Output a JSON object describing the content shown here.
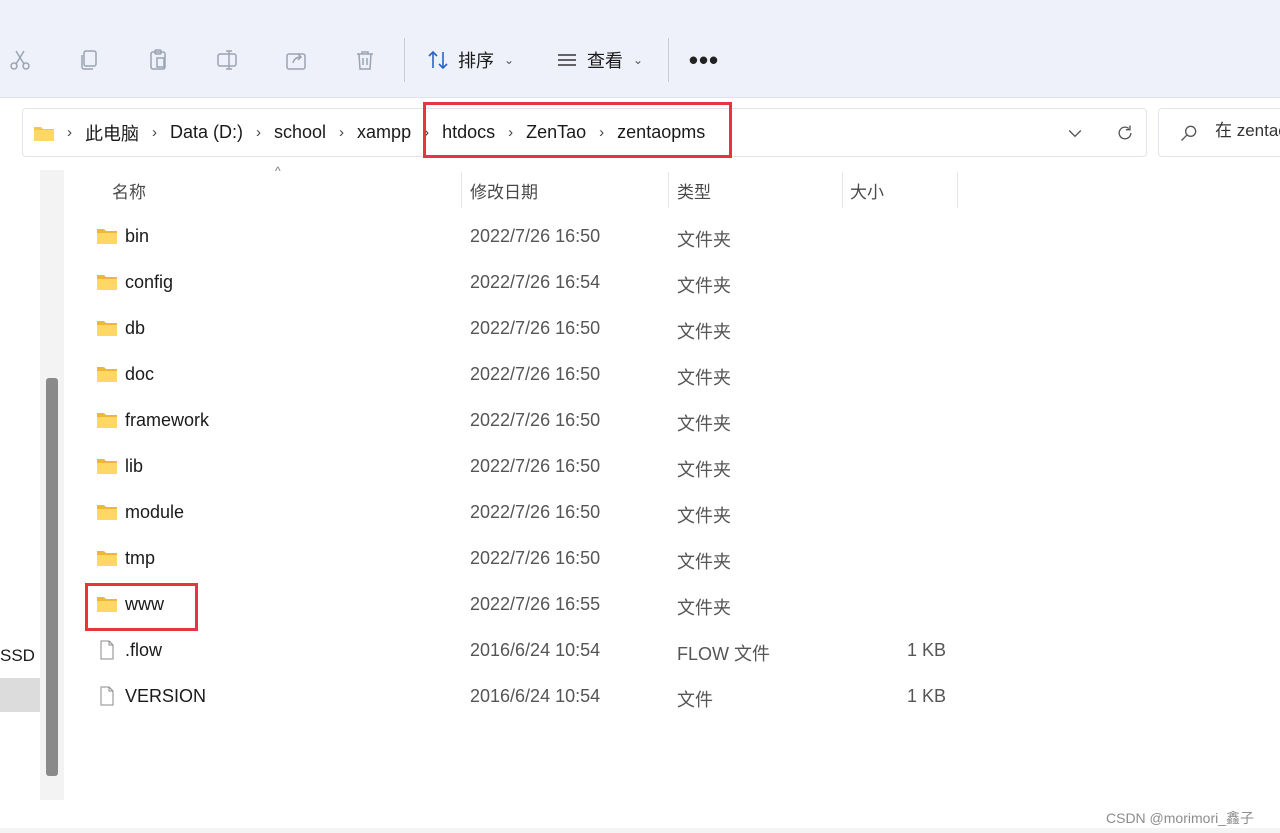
{
  "toolbar": {
    "icons": [
      "cut-icon",
      "copy-icon",
      "paste-icon",
      "rename-icon",
      "share-icon",
      "delete-icon"
    ],
    "sort_label": "排序",
    "view_label": "查看",
    "more_label": "•••"
  },
  "address": {
    "crumbs": [
      "此电脑",
      "Data (D:)",
      "school",
      "xampp",
      "htdocs",
      "ZenTao",
      "zentaopms"
    ]
  },
  "search": {
    "placeholder": "在 zentaopms 中搜索"
  },
  "nav": {
    "visible_label": "SSD"
  },
  "columns": {
    "name": "名称",
    "date": "修改日期",
    "type": "类型",
    "size": "大小"
  },
  "files": [
    {
      "name": "bin",
      "date": "2022/7/26 16:50",
      "type": "文件夹",
      "size": "",
      "icon": "folder-icon"
    },
    {
      "name": "config",
      "date": "2022/7/26 16:54",
      "type": "文件夹",
      "size": "",
      "icon": "folder-icon"
    },
    {
      "name": "db",
      "date": "2022/7/26 16:50",
      "type": "文件夹",
      "size": "",
      "icon": "folder-icon"
    },
    {
      "name": "doc",
      "date": "2022/7/26 16:50",
      "type": "文件夹",
      "size": "",
      "icon": "folder-icon"
    },
    {
      "name": "framework",
      "date": "2022/7/26 16:50",
      "type": "文件夹",
      "size": "",
      "icon": "folder-icon"
    },
    {
      "name": "lib",
      "date": "2022/7/26 16:50",
      "type": "文件夹",
      "size": "",
      "icon": "folder-icon"
    },
    {
      "name": "module",
      "date": "2022/7/26 16:50",
      "type": "文件夹",
      "size": "",
      "icon": "folder-icon"
    },
    {
      "name": "tmp",
      "date": "2022/7/26 16:50",
      "type": "文件夹",
      "size": "",
      "icon": "folder-icon"
    },
    {
      "name": "www",
      "date": "2022/7/26 16:55",
      "type": "文件夹",
      "size": "",
      "icon": "folder-icon"
    },
    {
      "name": ".flow",
      "date": "2016/6/24 10:54",
      "type": "FLOW 文件",
      "size": "1 KB",
      "icon": "file-icon"
    },
    {
      "name": "VERSION",
      "date": "2016/6/24 10:54",
      "type": "文件",
      "size": "1 KB",
      "icon": "file-icon"
    }
  ],
  "colors": {
    "highlight": "#e8353d",
    "folder": "#f5c451",
    "toolbar_bg": "#eef1f9"
  },
  "watermark": "CSDN @morimori_鑫子"
}
